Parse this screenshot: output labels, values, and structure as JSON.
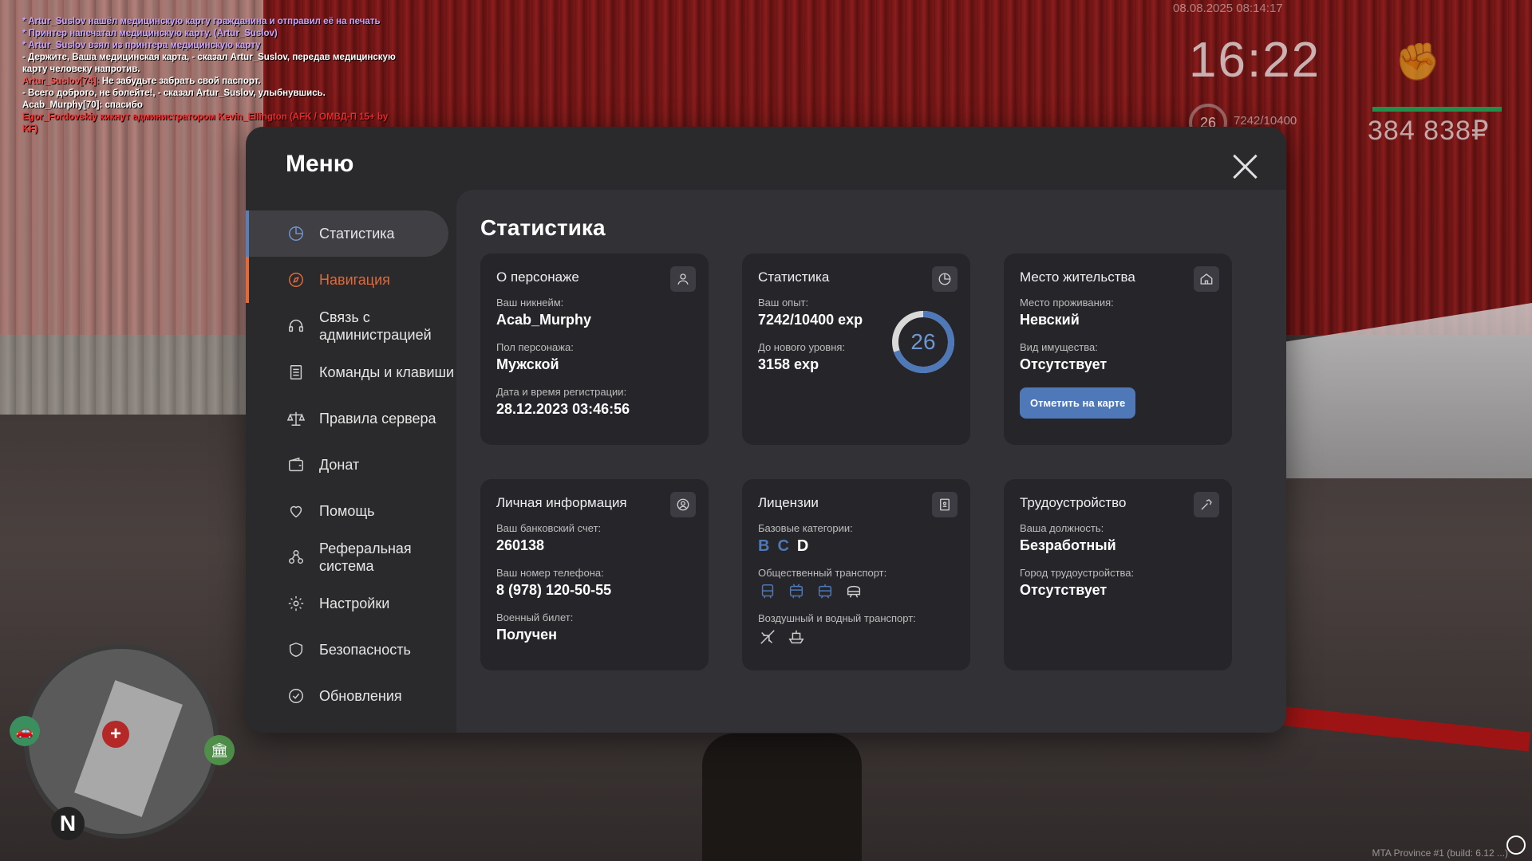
{
  "chat": [
    {
      "color": "purple",
      "text": "* Artur_Suslov нашёл медицинскую карту гражданина и отправил её на печать"
    },
    {
      "color": "purple",
      "text": "* Принтер напечатал медицинскую карту. (Artur_Suslov)"
    },
    {
      "color": "purple",
      "text": "* Artur_Suslov взял из принтера медицинскую карту"
    },
    {
      "color": "white",
      "text": "- Держите, Ваша медицинская карта, - сказал Artur_Suslov, передав медицинскую карту человеку напротив."
    },
    {
      "color": "white",
      "nick": "Artur_Suslov[74]:",
      "text": " Не забудьте забрать свой паспорт."
    },
    {
      "color": "white",
      "text": "- Всего доброго, не болейте!, - сказал Artur_Suslov, улыбнувшись."
    },
    {
      "color": "white",
      "text": "Acab_Murphy[70]: спасибо"
    },
    {
      "color": "red",
      "text": "Egor_Fordovskiy кикнут администратором Kevin_Ellington (AFK / ОМВД-П 15+ by KF)"
    }
  ],
  "hud": {
    "date": "08.08.2025 08:14:17",
    "time": "16:22",
    "level": "26",
    "exp": "7242/10400",
    "money": "384 838₽"
  },
  "minimap": {
    "north": "N"
  },
  "build_info": "MTA Province #1 (build: 6.12 ...)",
  "menu": {
    "title": "Меню",
    "nav": [
      {
        "label": "Статистика",
        "icon": "pie-chart-icon"
      },
      {
        "label": "Навигация",
        "icon": "compass-icon"
      },
      {
        "label": "Связь с администрацией",
        "icon": "headset-icon"
      },
      {
        "label": "Команды и клавиши",
        "icon": "list-icon"
      },
      {
        "label": "Правила сервера",
        "icon": "scales-icon"
      },
      {
        "label": "Донат",
        "icon": "wallet-icon"
      },
      {
        "label": "Помощь",
        "icon": "heart-hand-icon"
      },
      {
        "label": "Реферальная система",
        "icon": "referral-icon"
      },
      {
        "label": "Настройки",
        "icon": "gear-icon"
      },
      {
        "label": "Безопасность",
        "icon": "shield-icon"
      },
      {
        "label": "Обновления",
        "icon": "update-check-icon"
      }
    ],
    "active_index": 0,
    "hover_index": 1
  },
  "stats": {
    "title": "Статистика",
    "character": {
      "head": "О персонаже",
      "nick_label": "Ваш никнейм:",
      "nick": "Acab_Murphy",
      "gender_label": "Пол персонажа:",
      "gender": "Мужской",
      "reg_label": "Дата и время регистрации:",
      "reg": "28.12.2023 03:46:56"
    },
    "statistics": {
      "head": "Статистика",
      "exp_label": "Ваш опыт:",
      "exp": "7242/10400 exp",
      "next_label": "До нового уровня:",
      "next": "3158 exp",
      "level": "26",
      "progress": 0.696,
      "accent": "#4e78b8"
    },
    "residence": {
      "head": "Место жительства",
      "place_label": "Место проживания:",
      "place": "Невский",
      "property_label": "Вид имущества:",
      "property": "Отсутствует",
      "button": "Отметить на карте"
    },
    "personal": {
      "head": "Личная информация",
      "bank_label": "Ваш банковский счет:",
      "bank": "260138",
      "phone_label": "Ваш номер телефона:",
      "phone": "8 (978) 120-50-55",
      "military_label": "Военный билет:",
      "military": "Получен"
    },
    "licenses": {
      "head": "Лицензии",
      "base_label": "Базовые категории:",
      "categories": [
        {
          "letter": "B",
          "owned": false
        },
        {
          "letter": "C",
          "owned": false
        },
        {
          "letter": "D",
          "owned": true
        }
      ],
      "public_label": "Общественный транспорт:",
      "public_icons": [
        "bus-icon",
        "trolleybus-icon",
        "tram-icon",
        "metro-icon"
      ],
      "air_label": "Воздушный и водный транспорт:",
      "air_icons": [
        "plane-icon",
        "boat-icon"
      ]
    },
    "employment": {
      "head": "Трудоустройство",
      "position_label": "Ваша должность:",
      "position": "Безработный",
      "city_label": "Город трудоустройства:",
      "city": "Отсутствует"
    }
  }
}
